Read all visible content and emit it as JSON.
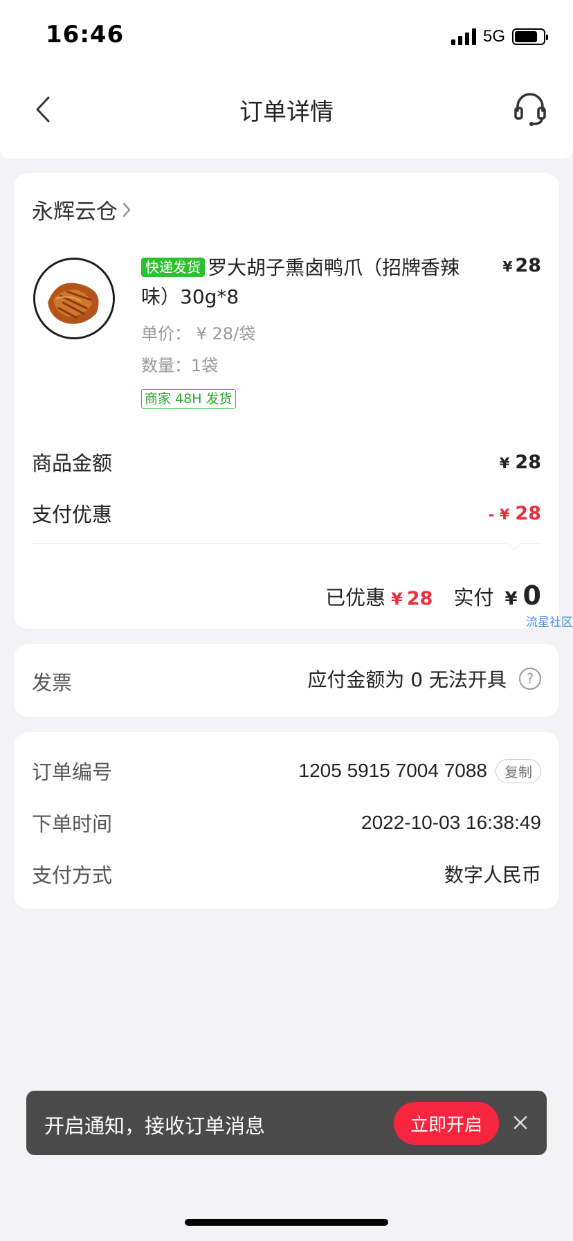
{
  "status_bar": {
    "time": "16:46",
    "network": "5G"
  },
  "header": {
    "title": "订单详情"
  },
  "store": {
    "name": "永辉云仓"
  },
  "product": {
    "express_tag": "快递发货",
    "title": "罗大胡子熏卤鸭爪（招牌香辣味）30g*8",
    "price_symbol": "¥",
    "price": "28",
    "unit_price": "单价： ¥ 28/袋",
    "quantity": "数量：1袋",
    "ship_tag": "商家 48H 发货"
  },
  "summary": {
    "goods_label": "商品金额",
    "goods_symbol": "¥",
    "goods_value": "28",
    "discount_label": "支付优惠",
    "discount_symbol": "- ¥",
    "discount_value": "28",
    "saved_label": "已优惠",
    "saved_symbol": "¥",
    "saved_value": "28",
    "paid_label": "实付",
    "paid_symbol": "¥",
    "paid_value": "0"
  },
  "watermark": "流星社区",
  "invoice": {
    "label": "发票",
    "value": "应付金额为 0 无法开具"
  },
  "order": {
    "number_label": "订单编号",
    "number": "1205 5915 7004 7088",
    "copy_label": "复制",
    "time_label": "下单时间",
    "time": "2022-10-03 16:38:49",
    "pay_label": "支付方式",
    "pay_method": "数字人民币"
  },
  "notification": {
    "text": "开启通知，接收订单消息",
    "button": "立即开启"
  },
  "colors": {
    "accent_red": "#e8303a",
    "express_green": "#2ec02e",
    "notify_button": "#f8253f"
  }
}
